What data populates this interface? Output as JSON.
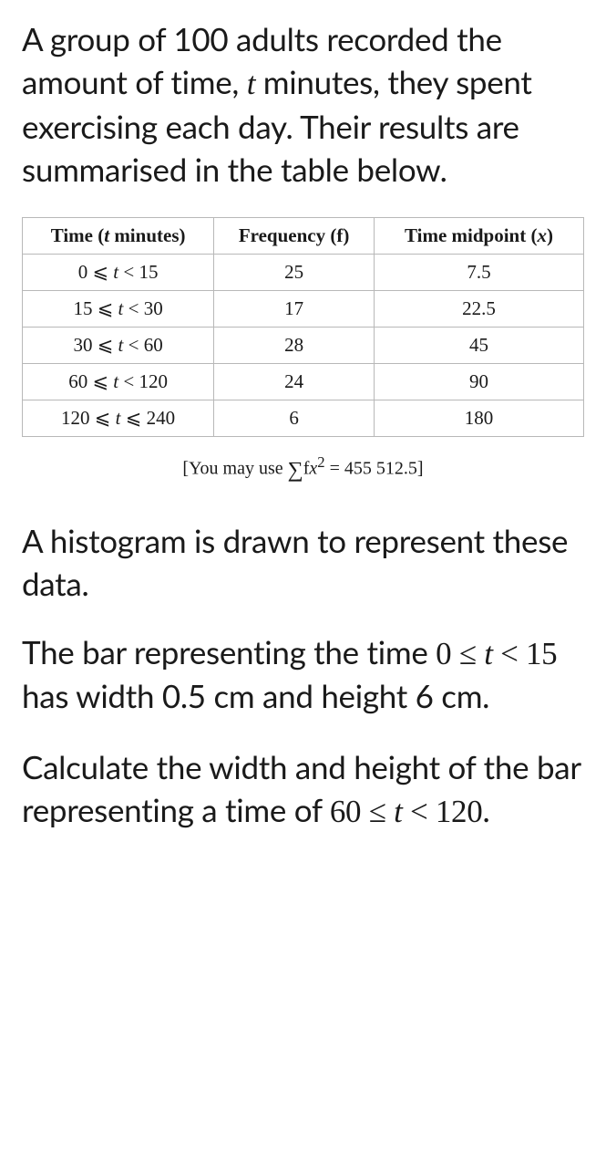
{
  "intro": {
    "part1": "A group of 100 adults recorded the amount of time, ",
    "var": "t",
    "part2": " minutes, they spent exercising each day. Their results are summarised in the table below."
  },
  "table": {
    "headers": {
      "time_label": "Time (",
      "time_var": "t",
      "time_label2": " minutes)",
      "freq": "Frequency (f)",
      "mid_label": "Time midpoint (",
      "mid_var": "x",
      "mid_label2": ")"
    },
    "rows": [
      {
        "range_a": "0 ⩽ ",
        "range_v": "t",
        "range_b": " < 15",
        "freq": "25",
        "mid": "7.5"
      },
      {
        "range_a": "15 ⩽ ",
        "range_v": "t",
        "range_b": " < 30",
        "freq": "17",
        "mid": "22.5"
      },
      {
        "range_a": "30 ⩽ ",
        "range_v": "t",
        "range_b": " < 60",
        "freq": "28",
        "mid": "45"
      },
      {
        "range_a": "60 ⩽ ",
        "range_v": "t",
        "range_b": " < 120",
        "freq": "24",
        "mid": "90"
      },
      {
        "range_a": "120 ⩽ ",
        "range_v": "t",
        "range_b": " ⩽ 240",
        "freq": "6",
        "mid": "180"
      }
    ]
  },
  "hint": {
    "open": "[You may use  ",
    "sigma": "∑",
    "fx": "f",
    "x": "x",
    "sq": "2",
    "eq": " = 455 512.5]"
  },
  "histogram_line": "A histogram is drawn to represent these data.",
  "bar_spec": {
    "p1": "The bar representing the time ",
    "math_a": "0 ≤ ",
    "math_v": "t",
    "math_b": " < 15",
    "p2": " has width 0.5 cm and height 6 cm."
  },
  "question": {
    "p1": "Calculate the width and height of the bar representing a time of ",
    "math_a": "60 ≤ ",
    "math_v": "t",
    "math_b": " < 120",
    "p2": "."
  },
  "chart_data": {
    "type": "table",
    "title": "Exercise time frequency distribution",
    "columns": [
      "Time (t minutes)",
      "Frequency (f)",
      "Time midpoint (x)"
    ],
    "rows": [
      [
        "0 ≤ t < 15",
        25,
        7.5
      ],
      [
        "15 ≤ t < 30",
        17,
        22.5
      ],
      [
        "30 ≤ t < 60",
        28,
        45
      ],
      [
        "60 ≤ t < 120",
        24,
        90
      ],
      [
        "120 ≤ t ≤ 240",
        6,
        180
      ]
    ],
    "sum_fx2": 455512.5,
    "n": 100,
    "reference_bar": {
      "class": "0 ≤ t < 15",
      "width_cm": 0.5,
      "height_cm": 6
    }
  }
}
